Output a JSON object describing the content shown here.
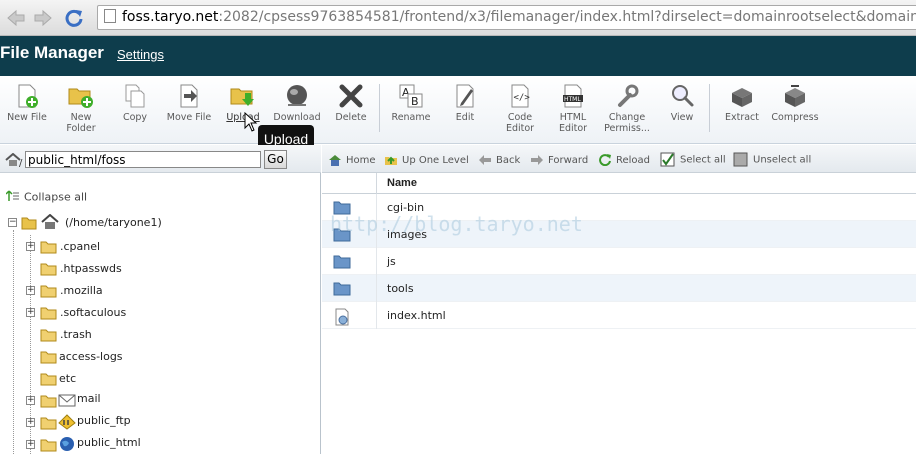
{
  "browser": {
    "url_host": "foss.taryo.net",
    "url_rest": ":2082/cpsess9763854581/frontend/x3/filemanager/index.html?dirselect=domainrootselect&domainselect=foss.taryo.net"
  },
  "header": {
    "title": "File Manager",
    "settings_label": "Settings",
    "background_color": "#0e3d4c"
  },
  "toolbar": {
    "new_file": "New File",
    "new_folder": "New\nFolder",
    "copy": "Copy",
    "move_file": "Move File",
    "upload": "Upload",
    "download": "Download",
    "delete": "Delete",
    "rename": "Rename",
    "edit": "Edit",
    "code_editor": "Code\nEditor",
    "html_editor": "HTML\nEditor",
    "change_permissions": "Change\nPermiss...",
    "view": "View",
    "extract": "Extract",
    "compress": "Compress"
  },
  "tooltip": "Upload",
  "left": {
    "path_value": "public_html/foss",
    "go_label": "Go",
    "collapse_all": "Collapse all",
    "tree": {
      "root": "(/home/taryone1)",
      "cpanel": ".cpanel",
      "htpasswds": ".htpasswds",
      "mozilla": ".mozilla",
      "softaculous": ".softaculous",
      "trash": ".trash",
      "access_logs": "access-logs",
      "etc": "etc",
      "mail": "mail",
      "public_ftp": "public_ftp",
      "public_html": "public_html"
    }
  },
  "right": {
    "nav": {
      "home": "Home",
      "up_one_level": "Up One Level",
      "back": "Back",
      "forward": "Forward",
      "reload": "Reload",
      "select_all": "Select all",
      "unselect_all": "Unselect all"
    },
    "column_name": "Name",
    "files": [
      "cgi-bin",
      "images",
      "js",
      "tools",
      "index.html"
    ]
  },
  "watermark": "http://blog.taryo.net"
}
